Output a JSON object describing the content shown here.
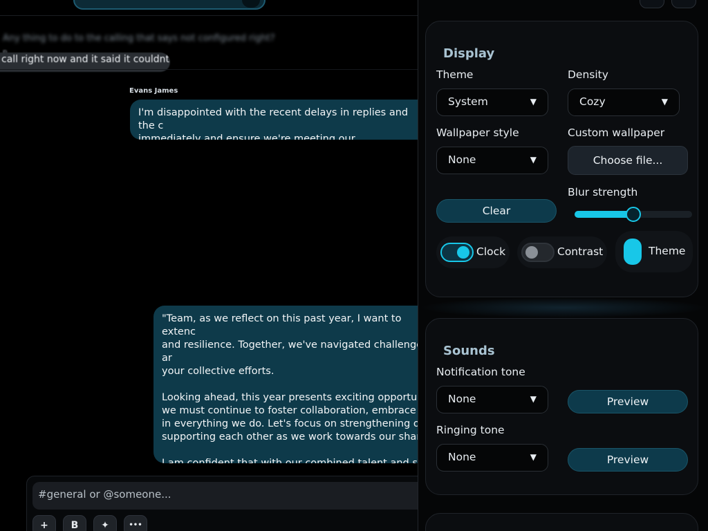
{
  "chat": {
    "quoted": {
      "blurred_line": "Any thing to do to the calling that says not configured right?",
      "small": "p",
      "bubble_text": "call right now and it said it couldnt"
    },
    "messages": [
      {
        "sender": "Evans James",
        "text": "I'm disappointed with the recent delays in replies and the c\nimmediately and ensure we're meeting our commitments."
      },
      {
        "sender": "",
        "text": "\"Team, as we reflect on this past year, I want to extenc\nand resilience. Together, we've navigated challenges ar\nyour collective efforts.\n\nLooking ahead, this year presents exciting opportuniti\nwe must continue to foster collaboration, embrace ne\nin everything we do. Let's focus on strengthening our\nsupporting each other as we work towards our shared\n\nI am confident that with our combined talent and spir\nforward with renewed energy and a clear vision for su"
      }
    ],
    "composer": {
      "placeholder": "#general or @someone...",
      "tools": [
        {
          "name": "add",
          "glyph": "+"
        },
        {
          "name": "bold",
          "glyph": "B"
        },
        {
          "name": "sparkle",
          "glyph": "✦"
        },
        {
          "name": "more",
          "glyph": "•••"
        }
      ]
    }
  },
  "settings": {
    "display": {
      "title": "Display",
      "theme_label": "Theme",
      "theme_value": "System",
      "density_label": "Density",
      "density_value": "Cozy",
      "wallpaper_label": "Wallpaper style",
      "wallpaper_value": "None",
      "custom_wallpaper_label": "Custom wallpaper",
      "choose_file_label": "Choose file...",
      "clear_label": "Clear",
      "blur_label": "Blur strength",
      "blur_fraction": 0.5,
      "toggles": {
        "clock": {
          "label": "Clock",
          "on": true
        },
        "contrast": {
          "label": "Contrast",
          "on": false
        },
        "theme": {
          "label": "Theme"
        }
      }
    },
    "sounds": {
      "title": "Sounds",
      "notification_label": "Notification tone",
      "notification_value": "None",
      "ringing_label": "Ringing tone",
      "ringing_value": "None",
      "preview_label": "Preview"
    },
    "arrow_glyph": "▼"
  },
  "colors": {
    "accent": "#18c7e8",
    "bubble": "#0e3a4a",
    "panel": "#0b0d10"
  }
}
